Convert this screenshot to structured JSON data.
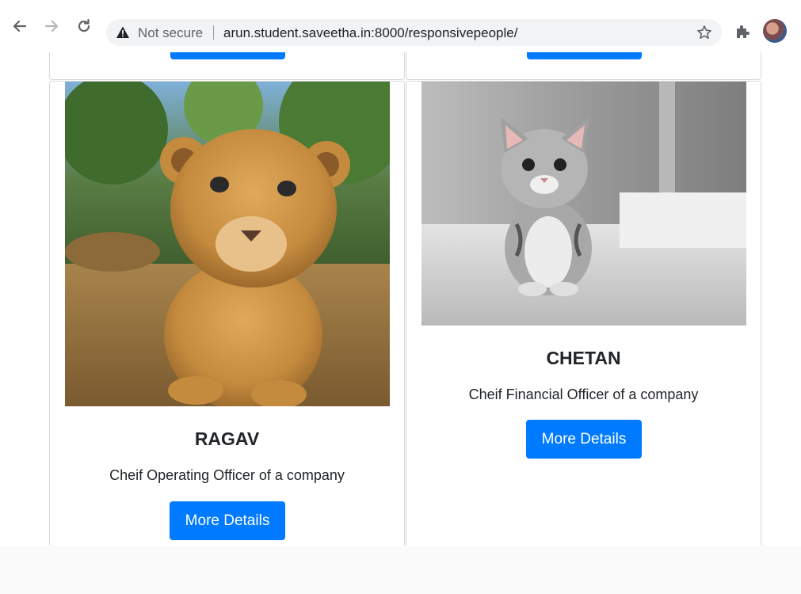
{
  "browser": {
    "security_label": "Not secure",
    "url": "arun.student.saveetha.in:8000/responsivepeople/"
  },
  "cards": [
    {
      "name": "RAGAV",
      "role": "Cheif Operating Officer of a company",
      "button": "More Details",
      "image": "lion-cub-photo"
    },
    {
      "name": "CHETAN",
      "role": "Cheif Financial Officer of a company",
      "button": "More Details",
      "image": "kitten-photo"
    }
  ],
  "colors": {
    "primary": "#007bff",
    "text": "#212529",
    "border": "#d8d8d8"
  }
}
